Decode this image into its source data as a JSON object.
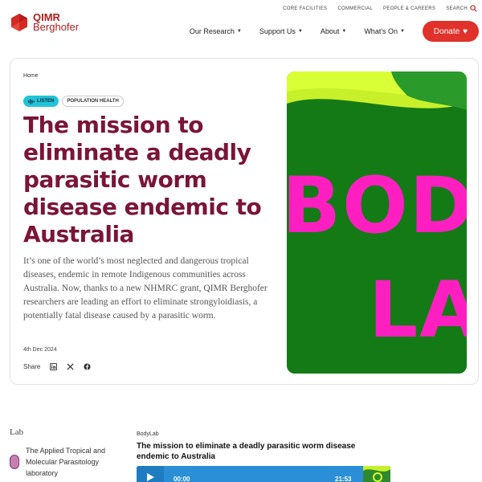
{
  "brand": {
    "line1": "QIMR",
    "line2": "Berghofer",
    "color": "#b11d1d"
  },
  "topnav": {
    "items": [
      "CORE FACILITIES",
      "COMMERCIAL",
      "PEOPLE & CAREERS"
    ],
    "search_label": "SEARCH",
    "search_icon": "search-icon"
  },
  "mainnav": {
    "items": [
      "Our Research",
      "Support Us",
      "About",
      "What's On"
    ],
    "donate_label": "Donate",
    "donate_color": "#e0312b"
  },
  "article": {
    "breadcrumb": "Home",
    "listen_label": "LISTEN",
    "topic_tag": "POPULATION HEALTH",
    "headline": "The mission to eliminate a deadly parasitic worm disease endemic to Australia",
    "headline_color": "#7a1538",
    "lede": "It’s one of the world’s most neglected and dangerous tropical diseases, endemic in remote Indigenous communities across Australia. Now, thanks to a new NHMRC grant, QIMR Berghofer researchers are leading an effort to eliminate strongyloidiasis, a potentially fatal disease caused by a parasitic worm.",
    "date": "4th Dec 2024",
    "share_label": "Share",
    "share_icons": [
      "linkedin-icon",
      "x-icon",
      "facebook-icon"
    ],
    "image_text": [
      "BOD",
      "LA"
    ]
  },
  "lab": {
    "section_label": "Lab",
    "name": "The Applied Tropical and Molecular Parasitology laboratory"
  },
  "podcast": {
    "source": "BodyLab",
    "title": "The mission to eliminate a deadly parasitic worm disease endemic to Australia",
    "time_start": "00:00",
    "time_end": "21:53"
  }
}
